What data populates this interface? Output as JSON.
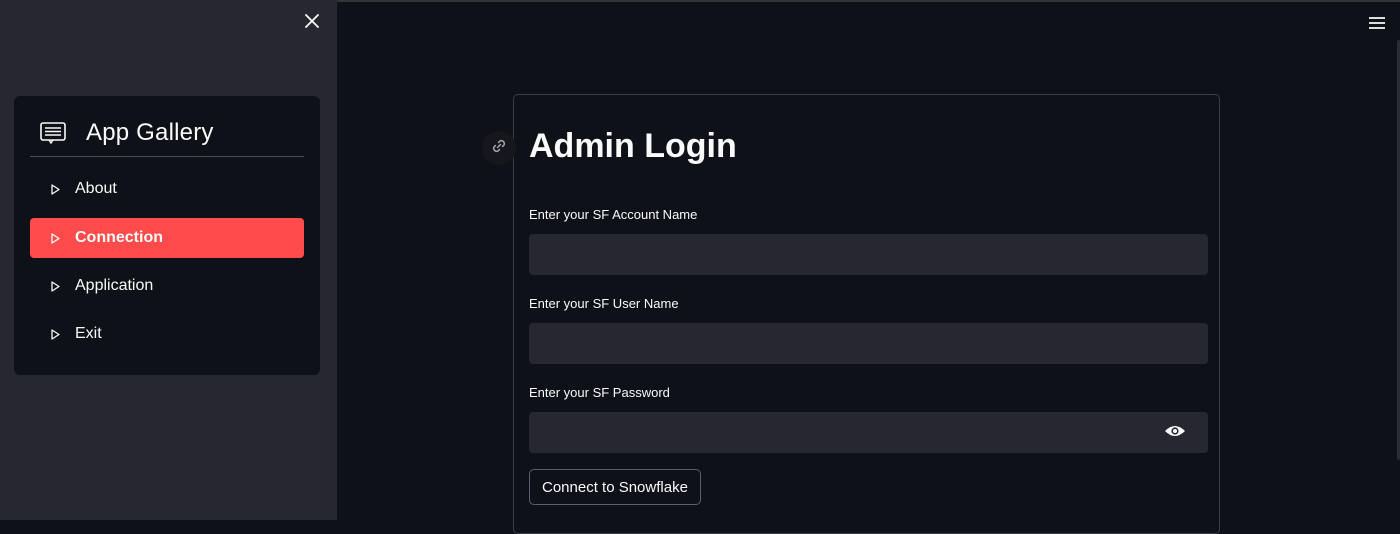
{
  "sidebar": {
    "close_icon": "close-icon",
    "menu_title": "App Gallery",
    "menu_icon": "gallery-list-icon",
    "items": [
      {
        "label": "About",
        "icon": "play-outline-icon",
        "active": false
      },
      {
        "label": "Connection",
        "icon": "play-outline-icon",
        "active": true
      },
      {
        "label": "Application",
        "icon": "play-outline-icon",
        "active": false
      },
      {
        "label": "Exit",
        "icon": "play-outline-icon",
        "active": false
      }
    ]
  },
  "header": {
    "menu_icon": "hamburger-icon"
  },
  "form": {
    "title": "Admin Login",
    "anchor_icon": "link-icon",
    "fields": [
      {
        "label": "Enter your SF Account Name",
        "value": "",
        "type": "text"
      },
      {
        "label": "Enter your SF User Name",
        "value": "",
        "type": "text"
      },
      {
        "label": "Enter your SF Password",
        "value": "",
        "type": "password",
        "toggle_icon": "eye-icon"
      }
    ],
    "submit_label": "Connect to Snowflake"
  },
  "colors": {
    "background": "#0e1117",
    "sidebar": "#262730",
    "accent": "#ff4b4b",
    "input_bg": "#262730",
    "text": "#fafafa"
  }
}
